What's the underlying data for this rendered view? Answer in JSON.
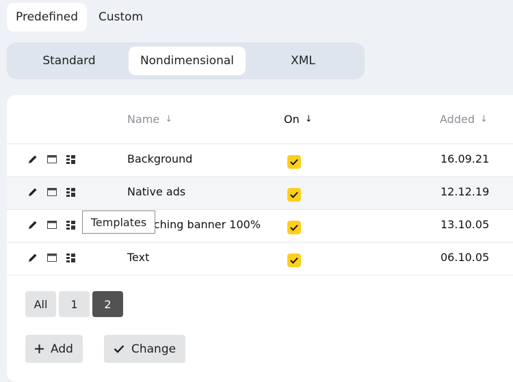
{
  "top_tabs": [
    {
      "label": "Predefined",
      "active": true
    },
    {
      "label": "Custom",
      "active": false
    }
  ],
  "segments": [
    {
      "label": "Standard",
      "active": false
    },
    {
      "label": "Nondimensional",
      "active": true
    },
    {
      "label": "XML",
      "active": false
    }
  ],
  "table": {
    "columns": {
      "name": "Name",
      "on": "On",
      "added": "Added"
    },
    "sort_arrow": "↓",
    "rows": [
      {
        "name": "Background",
        "on": true,
        "added": "16.09.21"
      },
      {
        "name": "Native ads",
        "on": true,
        "added": "12.12.19"
      },
      {
        "name": "Stretching banner 100%",
        "on": true,
        "added": "13.10.05"
      },
      {
        "name": "Text",
        "on": true,
        "added": "06.10.05"
      }
    ]
  },
  "tooltip": {
    "text": "Templates"
  },
  "pagination": {
    "all": "All",
    "pages": [
      "1",
      "2"
    ],
    "current": "2"
  },
  "actions": {
    "add": "Add",
    "change": "Change"
  },
  "colors": {
    "accent_checkbox": "#fccf1c",
    "active_page": "#525252",
    "background": "#eef1f6"
  }
}
